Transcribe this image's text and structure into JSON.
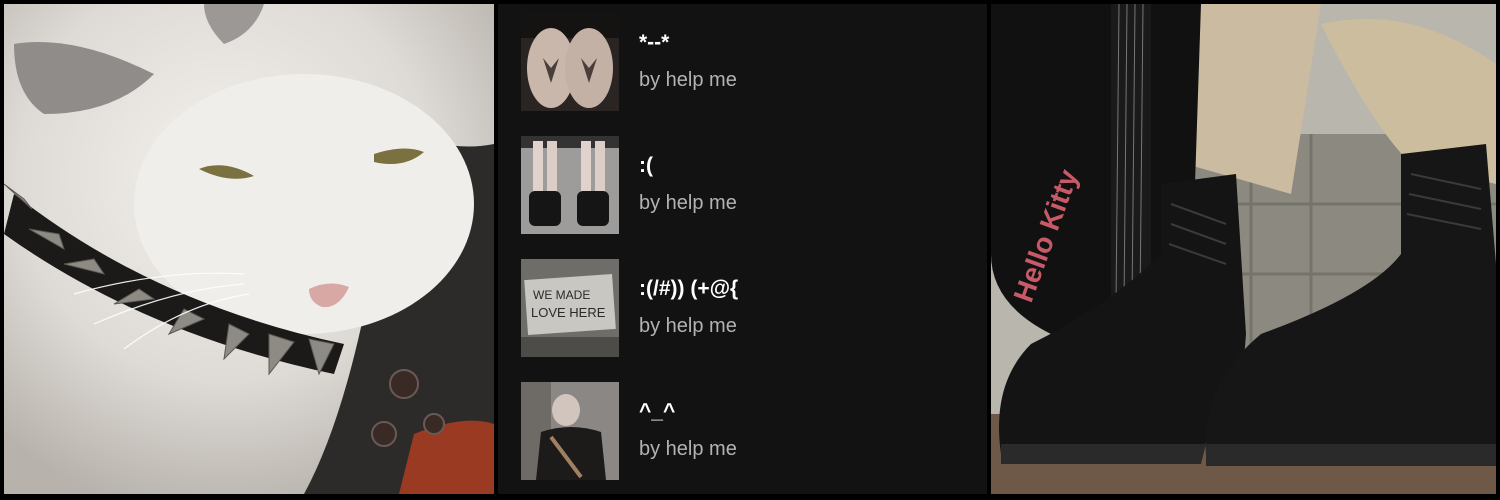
{
  "playlists": [
    {
      "title": "*--*",
      "subtitle": "by help me"
    },
    {
      "title": ":(",
      "subtitle": "by help me"
    },
    {
      "title": ":(/#)) (+@{",
      "subtitle": "by help me"
    },
    {
      "title": "^_^",
      "subtitle": "by help me"
    }
  ],
  "thumbs": {
    "sign_line1": "WE MADE",
    "sign_line2": "LOVE HERE"
  },
  "right_image": {
    "guitar_text": "Hello Kitty"
  },
  "colors": {
    "background": "#000000",
    "panel": "#121212",
    "title": "#ffffff",
    "subtitle": "#b3b3b3"
  }
}
